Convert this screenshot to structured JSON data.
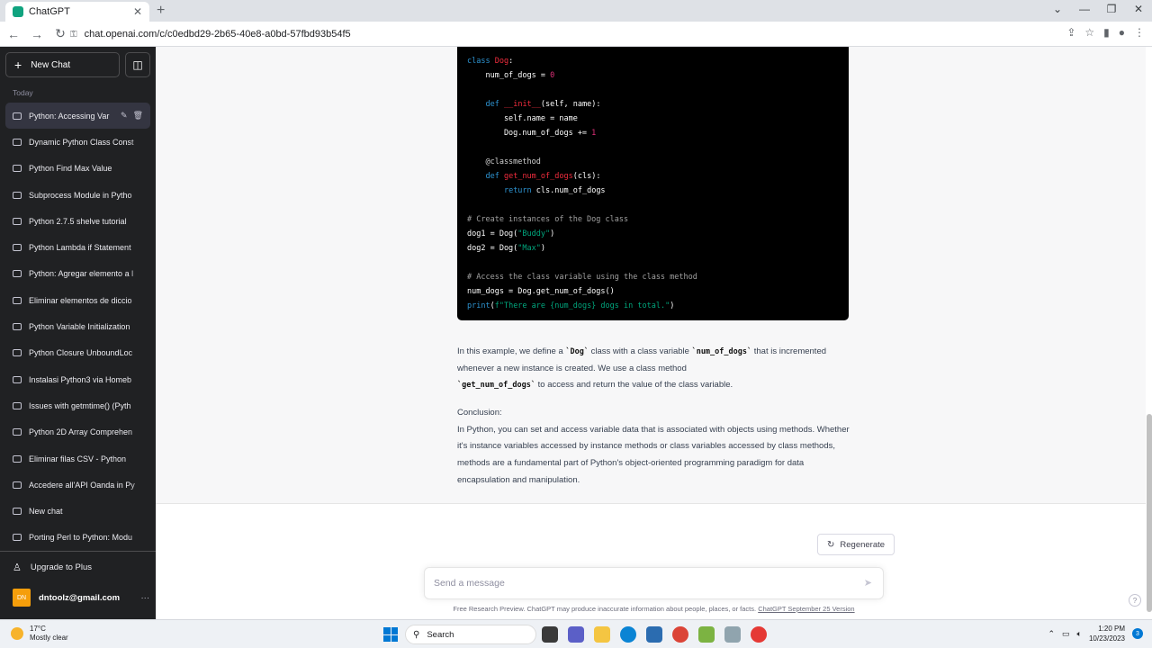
{
  "browser": {
    "tab_title": "ChatGPT",
    "url": "chat.openai.com/c/c0edbd29-2b65-40e8-a0bd-57fbd93b54f5"
  },
  "sidebar": {
    "new_chat": "New Chat",
    "section_today": "Today",
    "items": [
      {
        "label": "Python: Accessing Var"
      },
      {
        "label": "Dynamic Python Class Const"
      },
      {
        "label": "Python Find Max Value"
      },
      {
        "label": "Subprocess Module in Pytho"
      },
      {
        "label": "Python 2.7.5 shelve tutorial"
      },
      {
        "label": "Python Lambda if Statement"
      },
      {
        "label": "Python: Agregar elemento a l"
      },
      {
        "label": "Eliminar elementos de diccio"
      },
      {
        "label": "Python Variable Initialization"
      },
      {
        "label": "Python Closure UnboundLoc"
      },
      {
        "label": "Instalasi Python3 via Homeb"
      },
      {
        "label": "Issues with getmtime() (Pyth"
      },
      {
        "label": "Python 2D Array Comprehen"
      },
      {
        "label": "Eliminar filas CSV - Python"
      },
      {
        "label": "Accedere all'API Oanda in Py"
      },
      {
        "label": "New chat"
      },
      {
        "label": "Porting Perl to Python: Modu"
      }
    ],
    "upgrade": "Upgrade to Plus",
    "avatar_initials": "DN",
    "account_email": "dntoolz@gmail.com"
  },
  "code_lines": [
    "class Dog:",
    "    num_of_dogs = 0",
    "",
    "    def __init__(self, name):",
    "        self.name = name",
    "        Dog.num_of_dogs += 1",
    "",
    "    @classmethod",
    "    def get_num_of_dogs(cls):",
    "        return cls.num_of_dogs",
    "",
    "# Create instances of the Dog class",
    "dog1 = Dog(\"Buddy\")",
    "dog2 = Dog(\"Max\")",
    "",
    "# Access the class variable using the class method",
    "num_dogs = Dog.get_num_of_dogs()",
    "print(f\"There are {num_dogs} dogs in total.\")"
  ],
  "explanation": {
    "p1": "In this example, we define a ",
    "code1": "`Dog`",
    "p2": " class with a class variable ",
    "code2": "`num_of_dogs`",
    "p3": " that is incremented whenever a new instance is created. We use a class method ",
    "code3": "`get_num_of_dogs`",
    "p4": " to access and return the value of the class variable."
  },
  "conclusion": {
    "heading": "Conclusion:",
    "body": "In Python, you can set and access variable data that is associated with objects using methods. Whether it's instance variables accessed by instance methods or class variables accessed by class methods, methods are a fundamental part of Python's object-oriented programming paradigm for data encapsulation and manipulation."
  },
  "regenerate": "Regenerate",
  "composer": {
    "placeholder": "Send a message"
  },
  "footer": {
    "text": "Free Research Preview. ChatGPT may produce inaccurate information about people, places, or facts. ",
    "link": "ChatGPT September 25 Version"
  },
  "help": "?",
  "taskbar": {
    "temperature": "17°C",
    "weather": "Mostly clear",
    "search": "Search",
    "time": "1:20 PM",
    "date": "10/23/2023",
    "notifications": "3"
  },
  "colors": {
    "sidebar_bg": "#202123",
    "code_bg": "#000000",
    "keyword": "#2e95d3",
    "function": "#f22c3d",
    "string": "#00a67d"
  }
}
